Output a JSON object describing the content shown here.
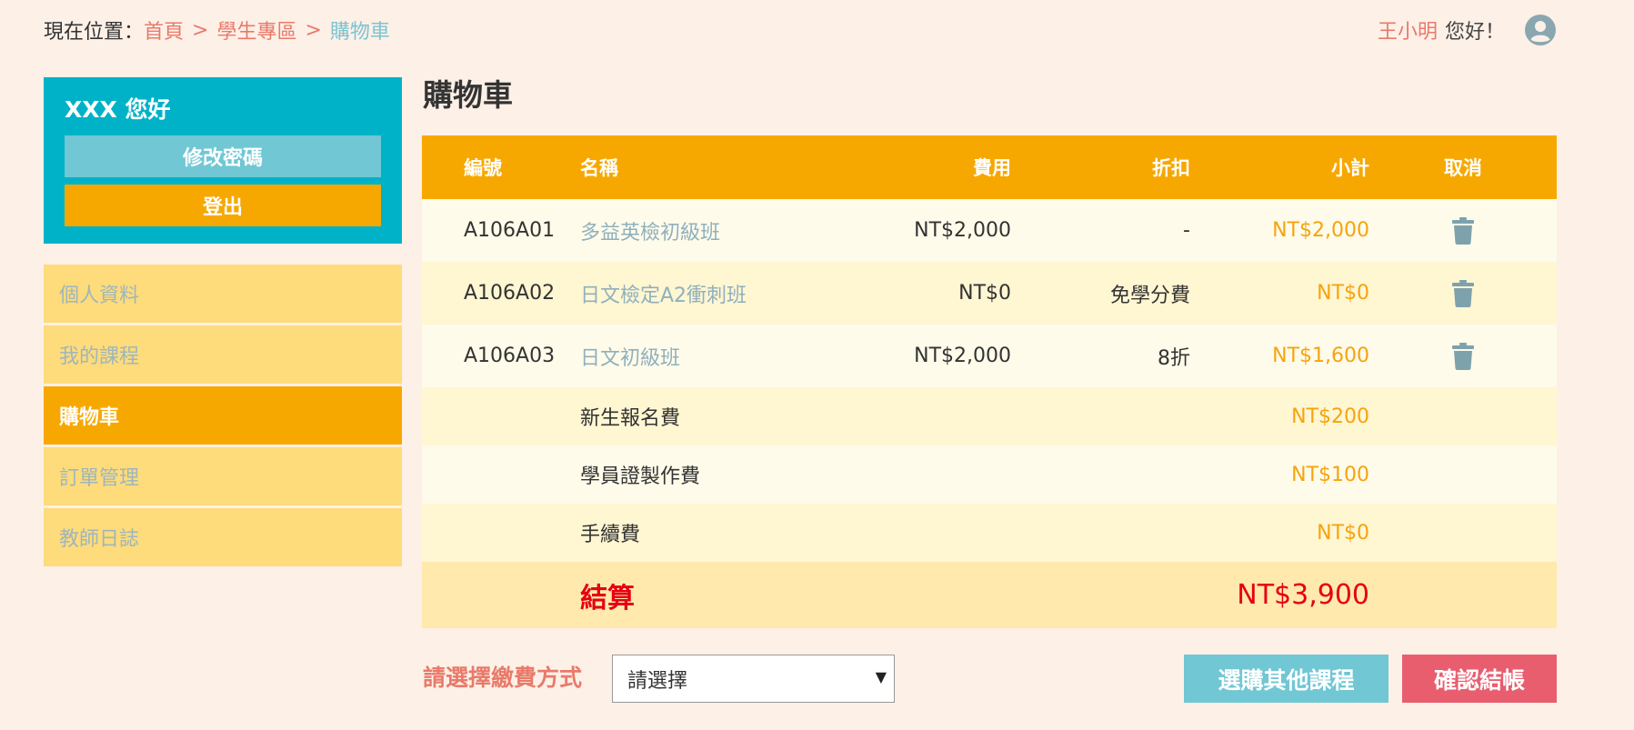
{
  "breadcrumb": {
    "prefix": "現在位置：",
    "items": [
      "首頁",
      "學生專區",
      "購物車"
    ],
    "separator": ">"
  },
  "user": {
    "name": "王小明",
    "greeting": "您好！",
    "icon": "user-circle-icon"
  },
  "account": {
    "title": "XXX 您好",
    "change_password": "修改密碼",
    "logout": "登出"
  },
  "sidebar": {
    "items": [
      {
        "label": "個人資料",
        "active": false
      },
      {
        "label": "我的課程",
        "active": false
      },
      {
        "label": "購物車",
        "active": true
      },
      {
        "label": "訂單管理",
        "active": false
      },
      {
        "label": "教師日誌",
        "active": false
      }
    ]
  },
  "page": {
    "title": "購物車"
  },
  "table": {
    "headers": {
      "id": "編號",
      "name": "名稱",
      "fee": "費用",
      "discount": "折扣",
      "subtotal": "小計",
      "cancel": "取消"
    },
    "items": [
      {
        "id": "A106A01",
        "name": "多益英檢初級班",
        "fee": "NT$2,000",
        "discount": "-",
        "subtotal": "NT$2,000"
      },
      {
        "id": "A106A02",
        "name": "日文檢定A2衝刺班",
        "fee": "NT$0",
        "discount": "免學分費",
        "subtotal": "NT$0"
      },
      {
        "id": "A106A03",
        "name": "日文初級班",
        "fee": "NT$2,000",
        "discount": "8折",
        "subtotal": "NT$1,600"
      }
    ],
    "fees": [
      {
        "name": "新生報名費",
        "subtotal": "NT$200"
      },
      {
        "name": "學員證製作費",
        "subtotal": "NT$100"
      },
      {
        "name": "手續費",
        "subtotal": "NT$0"
      }
    ],
    "total_label": "結算",
    "total_amount": "NT$3,900"
  },
  "payment": {
    "label": "請選擇繳費方式",
    "selected": "請選擇"
  },
  "actions": {
    "more_courses": "選購其他課程",
    "checkout": "確認結帳"
  },
  "colors": {
    "background": "#fdf0e7",
    "accent_orange": "#f7a800",
    "teal": "#00b2c7",
    "light_teal": "#71c7d4",
    "salmon": "#e97a6a",
    "red_button": "#e85e6e",
    "total_red": "#e60012"
  }
}
